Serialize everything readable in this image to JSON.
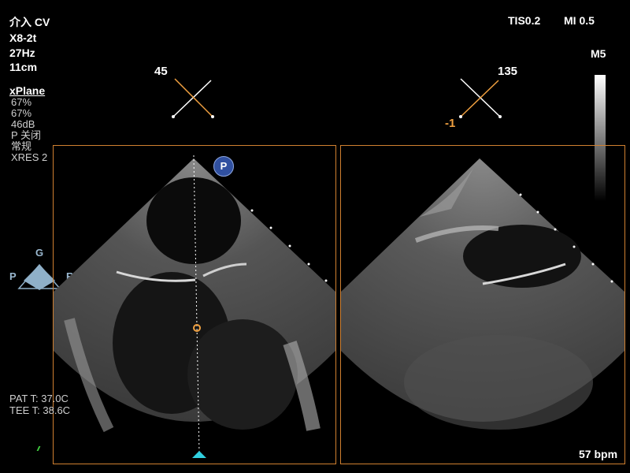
{
  "header": {
    "mode": "介入 CV",
    "probe": "X8-2t",
    "frame_rate": "27Hz",
    "depth": "11cm",
    "tis": "TIS0.2",
    "mi": "MI 0.5",
    "map": "M5"
  },
  "settings": {
    "xplane_title": "xPlane",
    "lines": [
      "67%",
      "67%",
      "46dB",
      "P 关闭",
      "常规",
      "XRES 2"
    ]
  },
  "orientation": {
    "top": "G",
    "left": "P",
    "right": "R"
  },
  "left_plane": {
    "angle": "45",
    "marker": "P"
  },
  "right_plane": {
    "angle": "135",
    "tilt": "-1"
  },
  "temperatures": {
    "patient": "PAT T: 37.0C",
    "tee": "TEE T: 38.6C"
  },
  "heart_rate": "57 bpm",
  "colors": {
    "frame": "#d08030",
    "accent": "#f0a040",
    "cursor": "#30d0e0"
  }
}
